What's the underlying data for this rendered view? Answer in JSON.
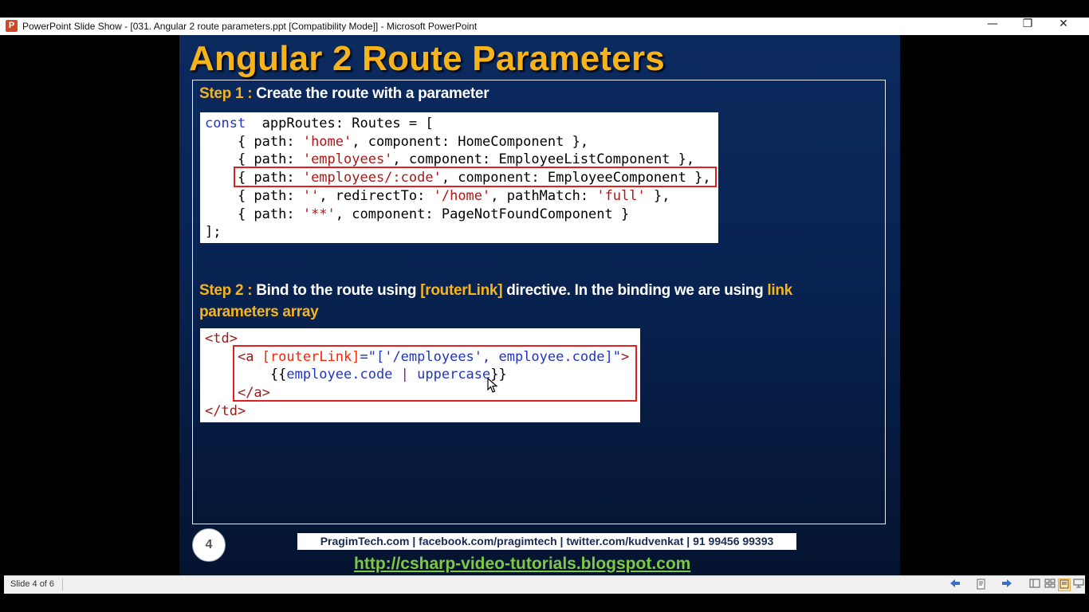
{
  "window": {
    "app_icon_letter": "P",
    "title": "PowerPoint Slide Show - [031. Angular 2 route parameters.ppt [Compatibility Mode]] - Microsoft PowerPoint",
    "controls": {
      "minimize": "—",
      "restore": "❐",
      "close": "✕"
    }
  },
  "slide": {
    "title": "Angular 2 Route Parameters",
    "step1": {
      "label": "Step 1 :",
      "text": " Create the route with a parameter"
    },
    "code1": [
      [
        [
          "kw",
          "const"
        ],
        [
          "",
          "  appRoutes: Routes = ["
        ]
      ],
      [
        [
          "",
          "    { path: "
        ],
        [
          "str",
          "'home'"
        ],
        [
          "",
          ", component: HomeComponent },"
        ]
      ],
      [
        [
          "",
          "    { path: "
        ],
        [
          "str",
          "'employees'"
        ],
        [
          "",
          ", component: EmployeeListComponent },"
        ]
      ],
      [
        [
          "",
          "    { path: "
        ],
        [
          "str",
          "'employees/:code'"
        ],
        [
          "",
          ", component: EmployeeComponent },"
        ]
      ],
      [
        [
          "",
          "    { path: "
        ],
        [
          "str",
          "''"
        ],
        [
          "",
          ", redirectTo: "
        ],
        [
          "str",
          "'/home'"
        ],
        [
          "",
          ", pathMatch: "
        ],
        [
          "str",
          "'full'"
        ],
        [
          "",
          " },"
        ]
      ],
      [
        [
          "",
          "    { path: "
        ],
        [
          "str",
          "'**'"
        ],
        [
          "",
          ", component: PageNotFoundComponent }"
        ]
      ],
      [
        [
          "",
          "];"
        ]
      ]
    ],
    "step2": {
      "label": "Step 2 :",
      "text1": " Bind to the route using ",
      "hl1": "[routerLink]",
      "text2": " directive. In the binding we are using ",
      "hl2": "link",
      "hl3": "parameters array"
    },
    "code2": [
      [
        [
          "tag",
          "<td>"
        ]
      ],
      [
        [
          "",
          "    "
        ],
        [
          "tag",
          "<a "
        ],
        [
          "attr",
          "[routerLink]"
        ],
        [
          "val",
          "=\"['/employees', employee.code]\""
        ],
        [
          "tag",
          ">"
        ]
      ],
      [
        [
          "",
          "        {{"
        ],
        [
          "val",
          "employee.code "
        ],
        [
          "pipe",
          "|"
        ],
        [
          "val",
          " uppercase"
        ],
        [
          "",
          "}}"
        ]
      ],
      [
        [
          "",
          "    "
        ],
        [
          "tag",
          "</a>"
        ]
      ],
      [
        [
          "tag",
          "</td>"
        ]
      ]
    ],
    "page_number": "4",
    "footer_contacts": "PragimTech.com | facebook.com/pragimtech | twitter.com/kudvenkat | 91 99456 99393",
    "footer_link": "http://csharp-video-tutorials.blogspot.com"
  },
  "statusbar": {
    "slide_indicator": "Slide 4 of 6",
    "icons": [
      "previous-icon",
      "notes-icon",
      "next-icon",
      "normal-view-icon",
      "slide-sorter-icon",
      "reading-view-icon",
      "slide-show-icon"
    ]
  },
  "colors": {
    "accent": "#f6b41a",
    "slide_bg": "#082352",
    "highlight_box": "#e02020",
    "link": "#7ec843"
  }
}
